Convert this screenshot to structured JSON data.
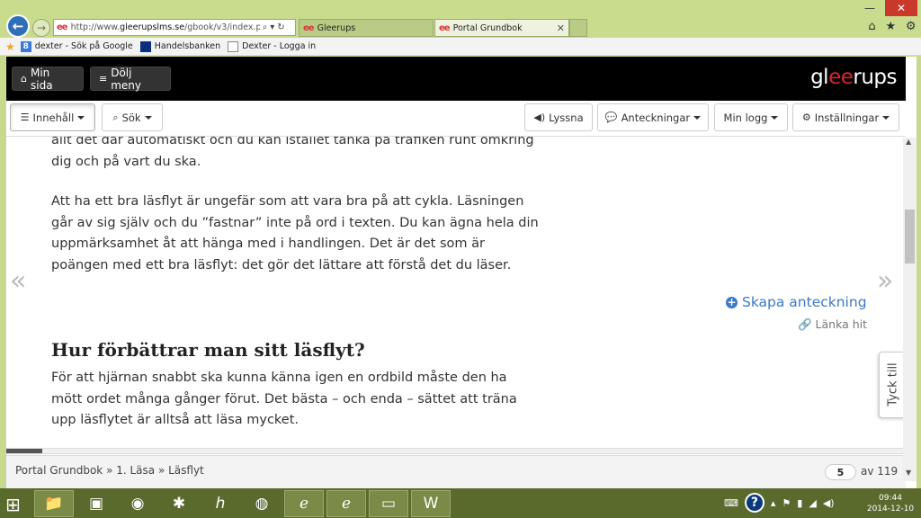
{
  "window": {
    "minimize": "—",
    "maximize": "□",
    "close": "✕"
  },
  "browser": {
    "url_prefix": "http://www.",
    "url_domain": "gleerupslms.se",
    "url_path": "/gbook/v3/index.php?id=",
    "tabs": [
      {
        "label": "Gleerups"
      },
      {
        "label": "Portal Grundbok"
      }
    ],
    "favorites": [
      {
        "label": "dexter - Sök på Google"
      },
      {
        "label": "Handelsbanken"
      },
      {
        "label": "Dexter - Logga in"
      }
    ]
  },
  "topnav": {
    "min_sida": "Min sida",
    "dolj_meny": "Dölj meny",
    "logo_pre": "gl",
    "logo_ee": "ee",
    "logo_post": "rups"
  },
  "toolbar": {
    "innehall": "Innehåll",
    "sok": "Sök",
    "lyssna": "Lyssna",
    "anteckningar": "Anteckningar",
    "min_logg": "Min logg",
    "installningar": "Inställningar"
  },
  "content": {
    "p0": "allt det där automatiskt och du kan istället tänka på trafiken runt omkring dig och på vart du ska.",
    "p1": "Att ha ett bra läsflyt är ungefär som att vara bra på att cykla. Läsningen går av sig själv och du ”fastnar” inte på ord i texten. Du kan ägna hela din uppmärksamhet åt att hänga med i handlingen. Det är det som är poängen med ett bra läsflyt: det gör det lättare att förstå det du läser.",
    "heading": "Hur förbättrar man sitt läsflyt?",
    "p2": "För att hjärnan snabbt ska kunna känna igen en ordbild måste den ha mött ordet många gånger förut. Det bästa – och enda – sättet att träna upp läsflytet är alltså att läsa mycket.",
    "skapa": "Skapa anteckning",
    "lanka": "Länka hit",
    "prev": "«",
    "next": "»",
    "tyck": "Tyck till"
  },
  "reading_progress": 0.04,
  "footer": {
    "breadcrumb": "Portal Grundbok » 1. Läsa » Läsflyt",
    "page": "5",
    "total": "av 119"
  },
  "taskbar": {
    "time": "09:44",
    "date": "2014-12-10"
  }
}
